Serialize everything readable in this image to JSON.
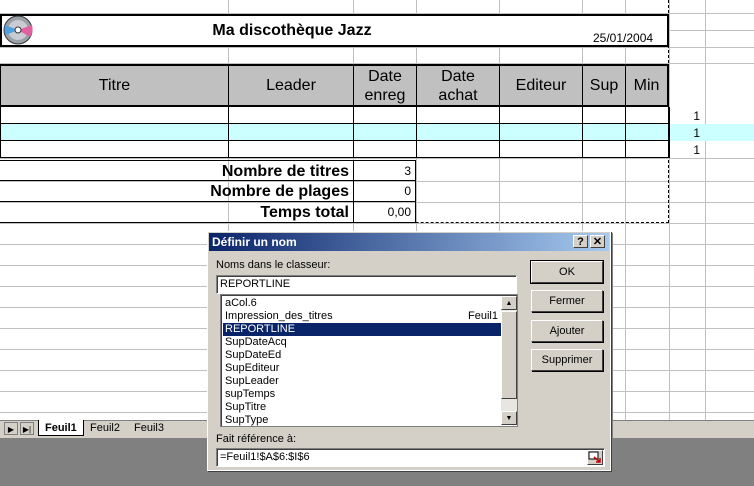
{
  "sheet": {
    "title": "Ma discothèque Jazz",
    "date": "25/01/2004",
    "headers": [
      "Titre",
      "Leader",
      "Date enreg",
      "Date achat",
      "Editeur",
      "Sup",
      "Min"
    ],
    "summary": [
      {
        "label": "Nombre de titres",
        "value": "3"
      },
      {
        "label": "Nombre de plages",
        "value": "0"
      },
      {
        "label": "Temps total",
        "value": "0,00"
      }
    ],
    "side_values": [
      "1",
      "1",
      "1"
    ],
    "tabs": [
      "Feuil1",
      "Feuil2",
      "Feuil3"
    ],
    "nav_icons": [
      "nav-last-icon",
      "nav-first-icon"
    ]
  },
  "dialog": {
    "title": "Définir un nom",
    "help_label": "?",
    "close_label": "✕",
    "names_label": "Noms dans le classeur:",
    "name_value": "REPORTLINE",
    "names": [
      {
        "name": "aCol.6",
        "ref": ""
      },
      {
        "name": "Impression_des_titres",
        "ref": "Feuil1"
      },
      {
        "name": "REPORTLINE",
        "ref": ""
      },
      {
        "name": "SupDateAcq",
        "ref": ""
      },
      {
        "name": "SupDateEd",
        "ref": ""
      },
      {
        "name": "SupEditeur",
        "ref": ""
      },
      {
        "name": "SupLeader",
        "ref": ""
      },
      {
        "name": "supTemps",
        "ref": ""
      },
      {
        "name": "SupTitre",
        "ref": ""
      },
      {
        "name": "SupType",
        "ref": ""
      }
    ],
    "selected_index": 2,
    "refers_label": "Fait référence à:",
    "refers_value": "=Feuil1!$A$6:$I$6",
    "buttons": {
      "ok": "OK",
      "close": "Fermer",
      "add": "Ajouter",
      "delete": "Supprimer"
    }
  },
  "colors": {
    "highlight_row": "#ccffff",
    "title_bar": "#0a246a",
    "selection": "#0a246a"
  }
}
